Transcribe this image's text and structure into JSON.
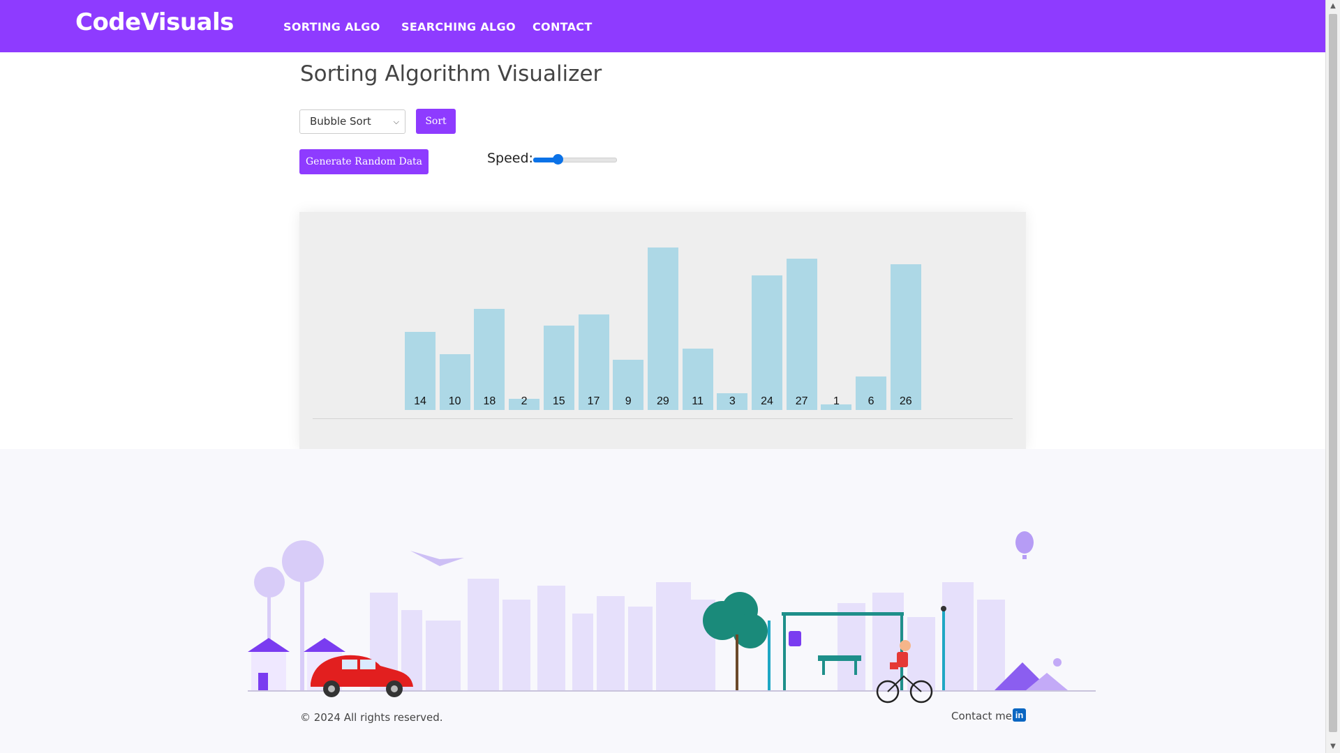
{
  "navbar": {
    "brand": "CodeVisuals",
    "links": [
      "SORTING ALGO",
      "SEARCHING ALGO",
      "CONTACT"
    ]
  },
  "main": {
    "title": "Sorting Algorithm Visualizer",
    "algorithm_select": "Bubble Sort",
    "sort_button": "Sort",
    "generate_button": "Generate Random Data",
    "speed_label": "Speed:",
    "speed_fraction": 0.3
  },
  "chart_data": {
    "type": "bar",
    "values": [
      14,
      10,
      18,
      2,
      15,
      17,
      9,
      29,
      11,
      3,
      24,
      27,
      1,
      6,
      26
    ],
    "bar_color": "#add8e6"
  },
  "footer": {
    "copyright": "© 2024 All rights reserved.",
    "contact_label": "Contact me:",
    "linkedin_icon": "in"
  },
  "colors": {
    "accent": "#8e3bff",
    "slider": "#0b72e7"
  }
}
